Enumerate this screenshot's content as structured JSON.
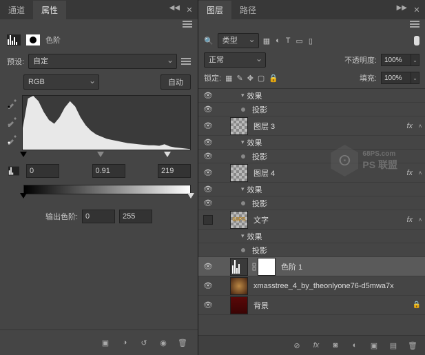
{
  "left_panel": {
    "tabs": {
      "channel": "通道",
      "properties": "属性"
    },
    "title": "色阶",
    "preset_label": "预设:",
    "preset_value": "自定",
    "channel_value": "RGB",
    "auto_btn": "自动",
    "input_black": "0",
    "input_mid": "0.91",
    "input_white": "219",
    "output_label": "输出色阶:",
    "output_black": "0",
    "output_white": "255"
  },
  "right_panel": {
    "tabs": {
      "layers": "图层",
      "paths": "路径"
    },
    "filter_label": "类型",
    "blend_mode": "正常",
    "opacity_label": "不透明度:",
    "opacity_value": "100%",
    "lock_label": "锁定:",
    "fill_label": "填充:",
    "fill_value": "100%",
    "layers": {
      "layer3": "图层 3",
      "layer4": "图层 4",
      "text_layer": "文字",
      "levels1": "色阶 1",
      "xmas": "xmasstree_4_by_theonlyone76-d5mwa7x",
      "background": "背景",
      "effects": "效果",
      "drop_shadow": "投影"
    },
    "fx": "fx"
  },
  "watermark": {
    "site": "68PS.com",
    "brand": "PS 联盟"
  },
  "chart_data": {
    "type": "bar",
    "title": "色阶",
    "xlabel": "",
    "ylabel": "",
    "categories": [
      0,
      8,
      16,
      24,
      32,
      40,
      48,
      56,
      64,
      72,
      80,
      88,
      96,
      104,
      112,
      120,
      128,
      136,
      144,
      152,
      160,
      168,
      176,
      184,
      192,
      200,
      208,
      216,
      224,
      232,
      240,
      248,
      255
    ],
    "values": [
      40,
      95,
      100,
      90,
      70,
      55,
      48,
      60,
      78,
      90,
      80,
      60,
      45,
      35,
      28,
      24,
      20,
      18,
      16,
      14,
      12,
      11,
      10,
      9,
      8,
      8,
      7,
      10,
      6,
      4,
      3,
      2,
      1
    ],
    "xlim": [
      0,
      255
    ],
    "ylim": [
      0,
      100
    ],
    "input_sliders": {
      "black": 0,
      "mid": 0.91,
      "white": 219
    },
    "output_sliders": {
      "black": 0,
      "white": 255
    }
  }
}
